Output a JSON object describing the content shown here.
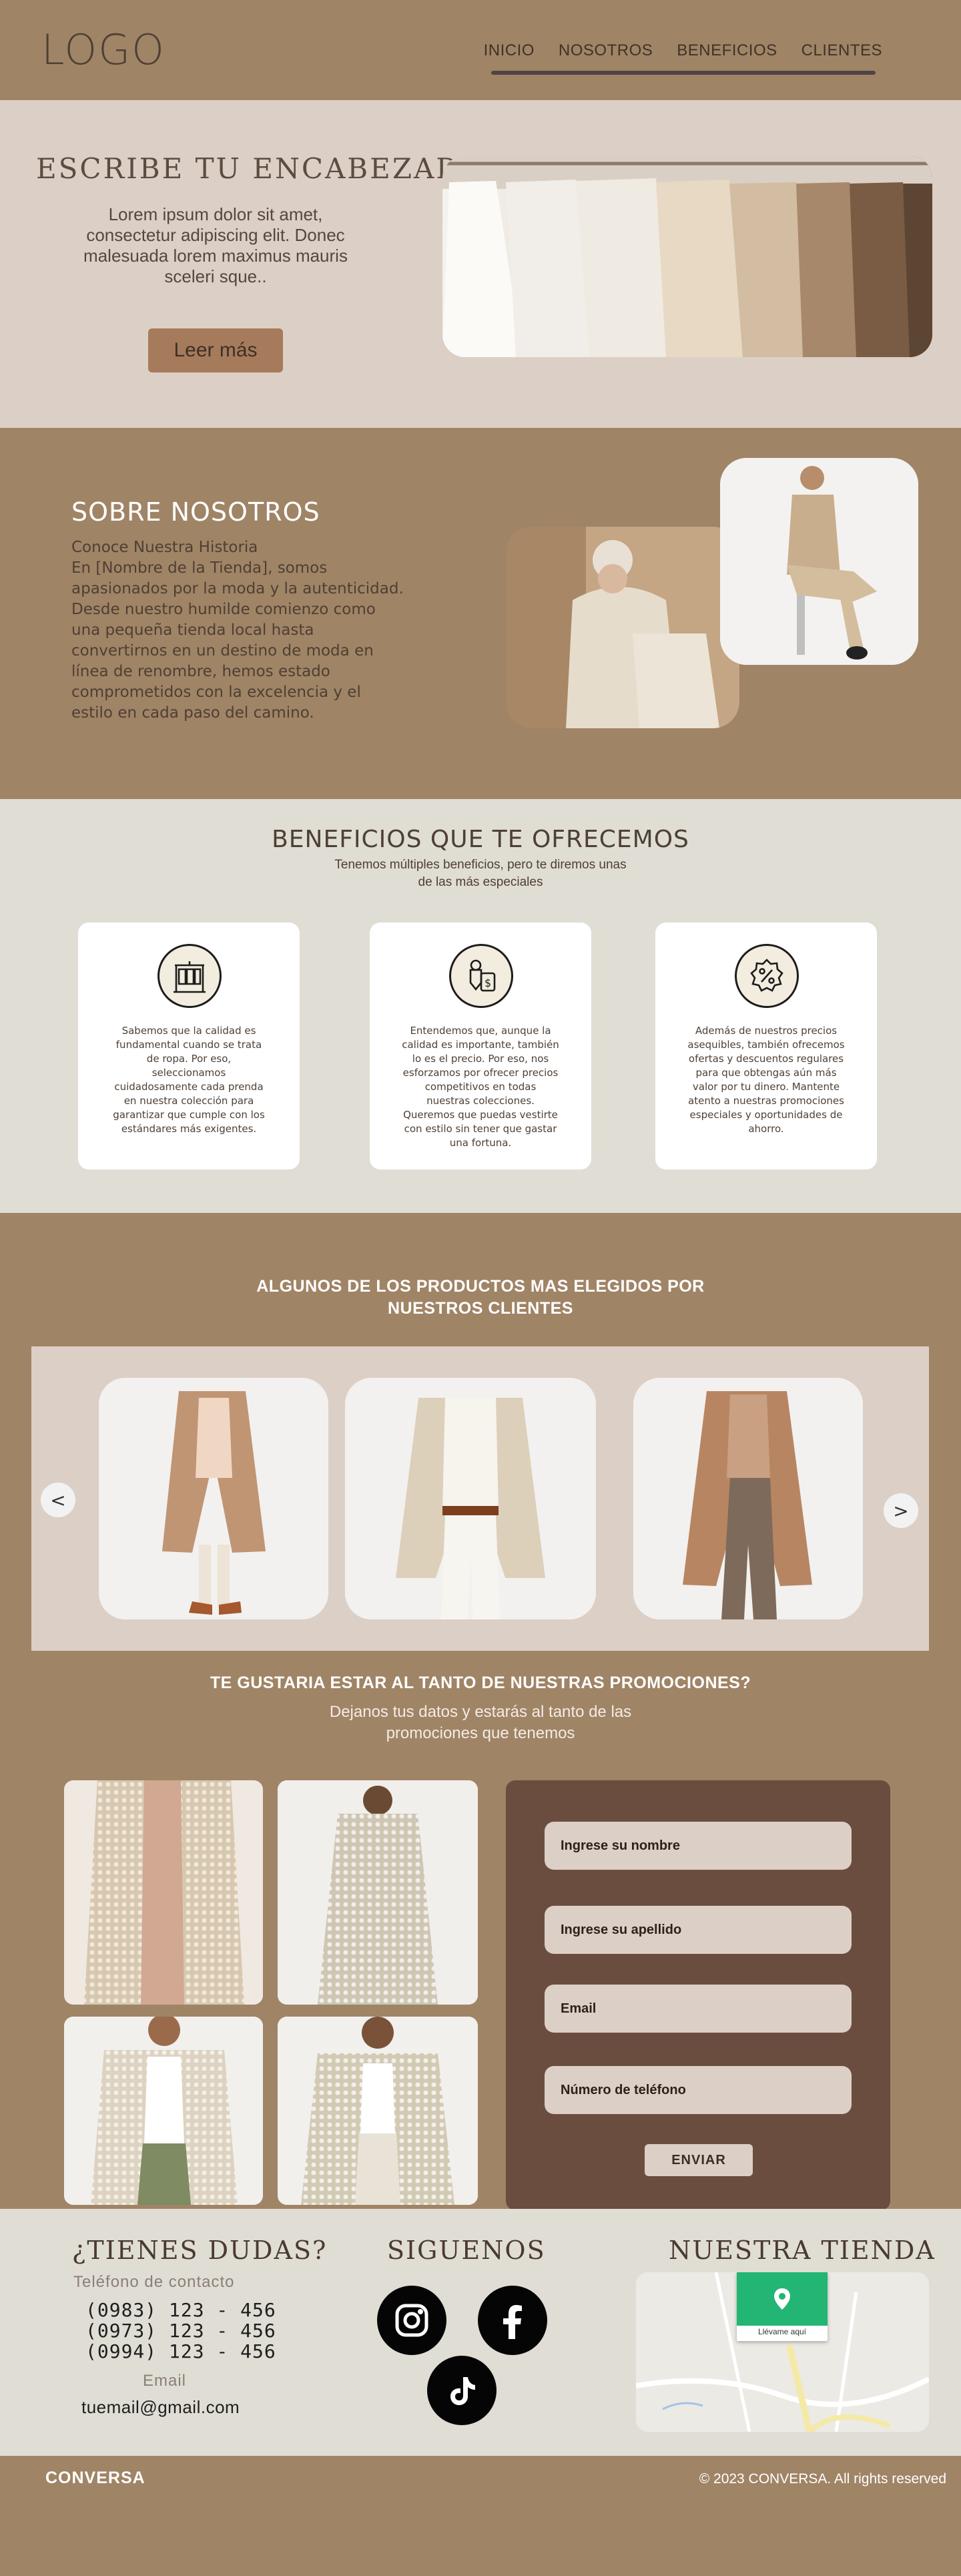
{
  "header": {
    "logo": "LOGO",
    "nav": [
      "INICIO",
      "NOSOTROS",
      "BENEFICIOS",
      "CLIENTES"
    ]
  },
  "hero": {
    "title": "Escribe tu encabezado",
    "text": "Lorem ipsum dolor sit amet, consectetur adipiscing elit. Donec malesuada lorem maximus mauris sceleri sque..",
    "button": "Leer más"
  },
  "about": {
    "title": "SOBRE NOSOTROS",
    "text": "Conoce Nuestra Historia\nEn [Nombre de la Tienda], somos apasionados por la moda y la autenticidad. Desde nuestro humilde comienzo como una pequeña tienda local hasta convertirnos en un destino de moda en línea de renombre, hemos estado comprometidos con la excelencia y el estilo en cada paso del camino."
  },
  "benefits": {
    "title": "BENEFICIOS QUE TE OFRECEMOS",
    "subtitle": "Tenemos múltiples beneficios, pero te diremos unas de las más especiales",
    "cards": [
      {
        "icon": "clothes-rack-icon",
        "text": "Sabemos que la calidad es fundamental cuando se trata de ropa. Por eso, seleccionamos cuidadosamente cada prenda en nuestra colección para garantizar que cumple con los estándares más exigentes."
      },
      {
        "icon": "price-tag-icon",
        "text": "Entendemos que, aunque la calidad es importante, también lo es el precio. Por eso, nos esforzamos por ofrecer precios competitivos en todas nuestras colecciones. Queremos que puedas vestirte con estilo sin tener que gastar una fortuna."
      },
      {
        "icon": "discount-badge-icon",
        "text": "Además de nuestros precios asequibles, también ofrecemos ofertas y descuentos regulares para que obtengas aún más valor por tu dinero. Mantente atento a nuestras promociones especiales y oportunidades de ahorro."
      }
    ]
  },
  "products": {
    "title": "ALGUNOS DE LOS PRODUCTOS MAS ELEGIDOS POR NUESTROS CLIENTES",
    "prev": "<",
    "next": ">"
  },
  "promo": {
    "title": "TE GUSTARIA ESTAR AL TANTO DE NUESTRAS PROMOCIONES?",
    "subtitle": "Dejanos tus datos y estarás al tanto de las promociones que tenemos",
    "fields": [
      "Ingrese su nombre",
      "Ingrese su apellido",
      "Email",
      "Número de teléfono"
    ],
    "button": "ENVIAR"
  },
  "contact": {
    "doubts_title": "¿TIENES DUDAS?",
    "phone_label": "Teléfono de contacto",
    "phones": [
      "(0983) 123 - 456",
      "(0973) 123 - 456",
      "(0994) 123 - 456"
    ],
    "email_label": "Email",
    "email": "tuemail@gmail.com",
    "follow_title": "SIGUENOS",
    "store_title": "NUESTRA TIENDA",
    "map_button": "Llévame aquí"
  },
  "footer": {
    "brand": "CONVERSA",
    "copyright": "© 2023 CONVERSA. All rights reserved"
  },
  "colors": {
    "brown": "#a08466",
    "beige": "#dccfc6",
    "light": "#e0ddd4",
    "dark_panel": "#6b4d3f"
  }
}
